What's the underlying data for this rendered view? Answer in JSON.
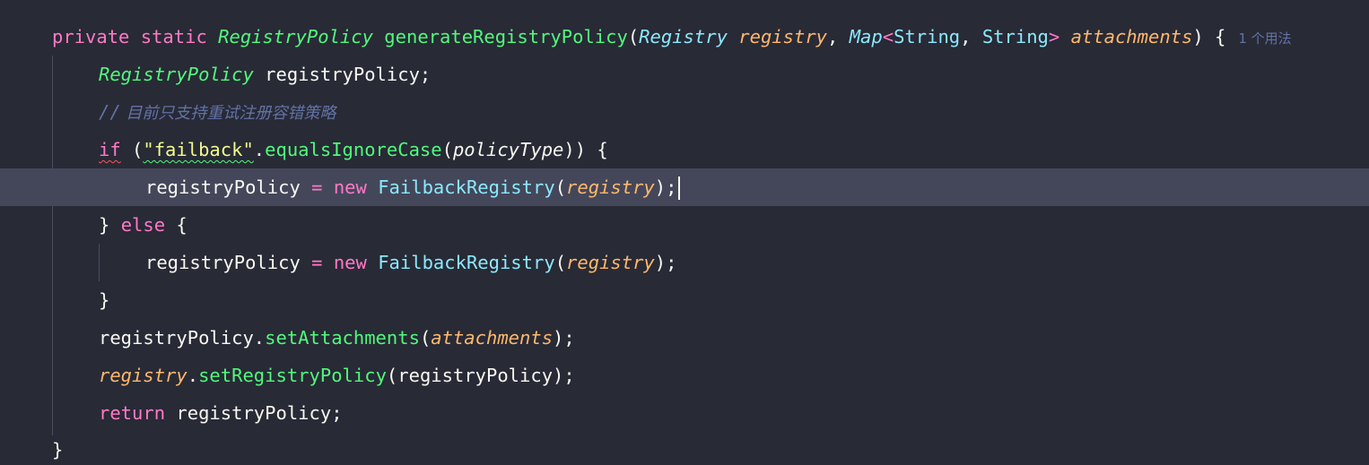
{
  "editor": {
    "lines": [
      {
        "tokens": [
          "private",
          "static",
          "RegistryPolicy",
          "generateRegistryPolicy",
          "(",
          "Registry",
          "registry",
          ", ",
          "Map",
          "<",
          "String",
          ", ",
          "String",
          ">",
          "attachments",
          ") {"
        ],
        "hint": "1 个用法"
      },
      {
        "tokens": [
          "RegistryPolicy",
          " registryPolicy;"
        ]
      },
      {
        "tokens": [
          "//",
          " 目前只支持重试注册容错策略"
        ]
      },
      {
        "tokens": [
          "if",
          " (",
          "\"failback\"",
          ".",
          "equalsIgnoreCase",
          "(",
          "policyType",
          ")) {"
        ]
      },
      {
        "tokens": [
          "registryPolicy",
          " = ",
          "new",
          " ",
          "FailbackRegistry",
          "(",
          "registry",
          ");"
        ]
      },
      {
        "tokens": [
          "} ",
          "else",
          " {"
        ]
      },
      {
        "tokens": [
          "registryPolicy",
          " = ",
          "new",
          " ",
          "FailbackRegistry",
          "(",
          "registry",
          ");"
        ]
      },
      {
        "tokens": [
          "}"
        ]
      },
      {
        "tokens": [
          "registryPolicy",
          ".",
          "setAttachments",
          "(",
          "attachments",
          ");"
        ]
      },
      {
        "tokens": [
          "registry",
          ".",
          "setRegistryPolicy",
          "(registryPolicy);"
        ]
      },
      {
        "tokens": [
          "return",
          " registryPolicy;"
        ]
      },
      {
        "tokens": [
          "}"
        ]
      }
    ]
  },
  "colors": {
    "background": "#282a36",
    "current_line": "#44475a",
    "keyword": "#ff79c6",
    "type": "#50fa7b",
    "builtin_type": "#8be9fd",
    "parameter": "#ffb86c",
    "string": "#f1fa8c",
    "comment": "#6272a4"
  }
}
